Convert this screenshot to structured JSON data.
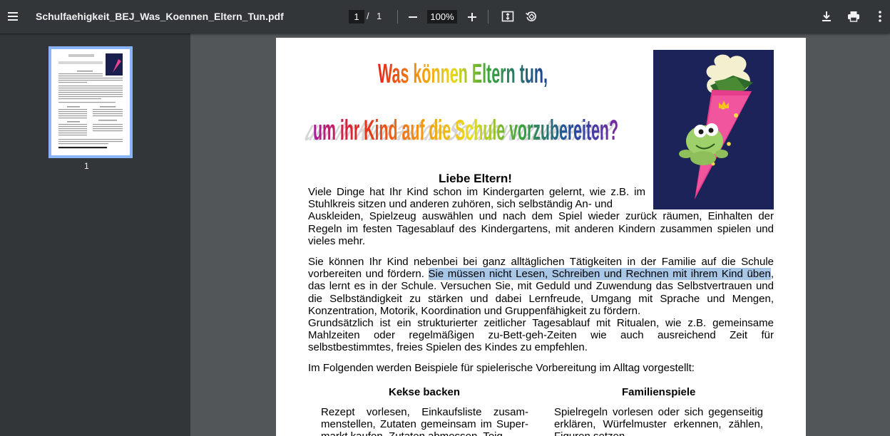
{
  "toolbar": {
    "title": "Schulfaehigkeit_BEJ_Was_Koennen_Eltern_Tun.pdf",
    "page_current": "1",
    "page_sep": "/",
    "page_total": "1",
    "zoom": "100%"
  },
  "sidebar": {
    "thumb_label": "1"
  },
  "document": {
    "headline_line1": "Was können Eltern tun,",
    "headline_line2": "um ihr Kind auf die Schule vorzubereiten?",
    "greeting": "Liebe Eltern!",
    "para1": "Viele Dinge hat Ihr Kind schon im Kindergarten gelernt, wie z.B. im Stuhlkreis sitzen und anderen zuhören, sich selbständig An- und Auskleiden, Spielzeug auswählen und nach dem Spiel wieder zurück räumen, Einhalten der Regeln im festen Tagesablauf des Kindergartens, mit anderen Kindern zusammen spielen und vieles mehr.",
    "para2_before": "Sie können Ihr Kind nebenbei bei ganz alltäglichen Tätigkeiten in der Familie auf die Schule vorbereiten und fördern. ",
    "para2_highlight": "Sie müssen nicht Lesen, Schreiben und Rechnen mit ihrem Kind üben",
    "para2_after": ", das lernt es in der Schule. Versuchen Sie, mit Geduld und Zuwendung das Selbstvertrauen und die Selbständigkeit zu stärken und dabei Lernfreude, Umgang mit Sprache und Mengen, Konzentration, Motorik, Koordination und Gruppenfähigkeit zu fördern.",
    "para3": "Grundsätzlich ist ein strukturierter zeitlicher Tagesablauf mit Ritualen, wie z.B. gemeinsame Mahlzeiten oder regelmäßigen zu-Bett-geh-Zeiten wie auch ausreichend Zeit für selbstbestimmtes, freies Spielen des Kindes zu empfehlen.",
    "para4": "Im Folgenden werden Beispiele für spielerische Vorbereitung im Alltag vorgestellt:",
    "col1_heading": "Kekse backen",
    "col1_text": "Rezept vorlesen, Einkaufsliste zusam-menstellen, Zutaten gemeinsam im Super-markt kaufen, Zutaten abmessen, Teig",
    "col2_heading": "Familienspiele",
    "col2_text": "Spielregeln vorlesen oder sich gegenseitig erklären, Würfelmuster erkennen, zählen, Figuren setzen,"
  },
  "colors": {
    "toolbar_bg": "#323639",
    "viewer_bg": "#525659",
    "accent": "#8ab4f8",
    "highlight": "#a8c7e7"
  },
  "icons": [
    "menu-icon",
    "remove-icon",
    "add-icon",
    "fit-page-icon",
    "rotate-icon",
    "download-icon",
    "print-icon",
    "more-vert-icon"
  ]
}
